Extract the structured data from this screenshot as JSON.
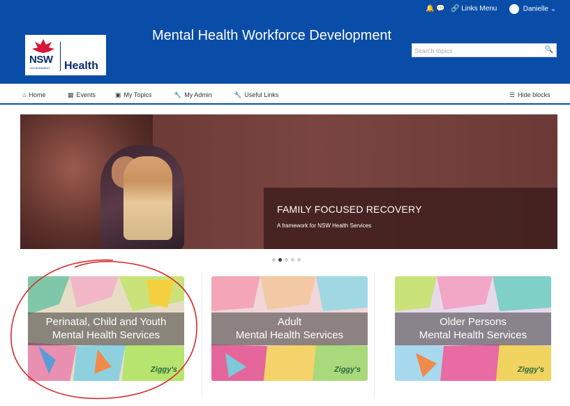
{
  "topbar": {
    "links_menu": "Links Menu",
    "user_name": "Danielle"
  },
  "header": {
    "site_title": "Mental Health Workforce Development",
    "logo_nsw": "NSW",
    "logo_government": "GOVERNMENT",
    "logo_health": "Health"
  },
  "search": {
    "placeholder": "Search topics"
  },
  "nav": {
    "items": [
      {
        "label": "Home",
        "icon": "home-icon"
      },
      {
        "label": "Events",
        "icon": "calendar-icon"
      },
      {
        "label": "My Topics",
        "icon": "briefcase-icon"
      },
      {
        "label": "My Admin",
        "icon": "wrench-icon"
      },
      {
        "label": "Useful Links",
        "icon": "wrench-icon"
      }
    ],
    "hide_blocks": "Hide blocks"
  },
  "hero": {
    "title": "FAMILY FOCUSED RECOVERY",
    "subtitle": "A framework for NSW Health Services",
    "slide_count": 5,
    "active_slide": 2
  },
  "cards": [
    {
      "line1": "Perinatal, Child and Youth",
      "line2": "Mental Health Services",
      "signature": "Ziggy's"
    },
    {
      "line1": "Adult",
      "line2": "Mental Health Services",
      "signature": "Ziggy's"
    },
    {
      "line1": "Older Persons",
      "line2": "Mental Health Services",
      "signature": "Ziggy's"
    }
  ],
  "colors": {
    "brand_blue": "#0a4da8",
    "annotation_red": "#d42a2a"
  }
}
